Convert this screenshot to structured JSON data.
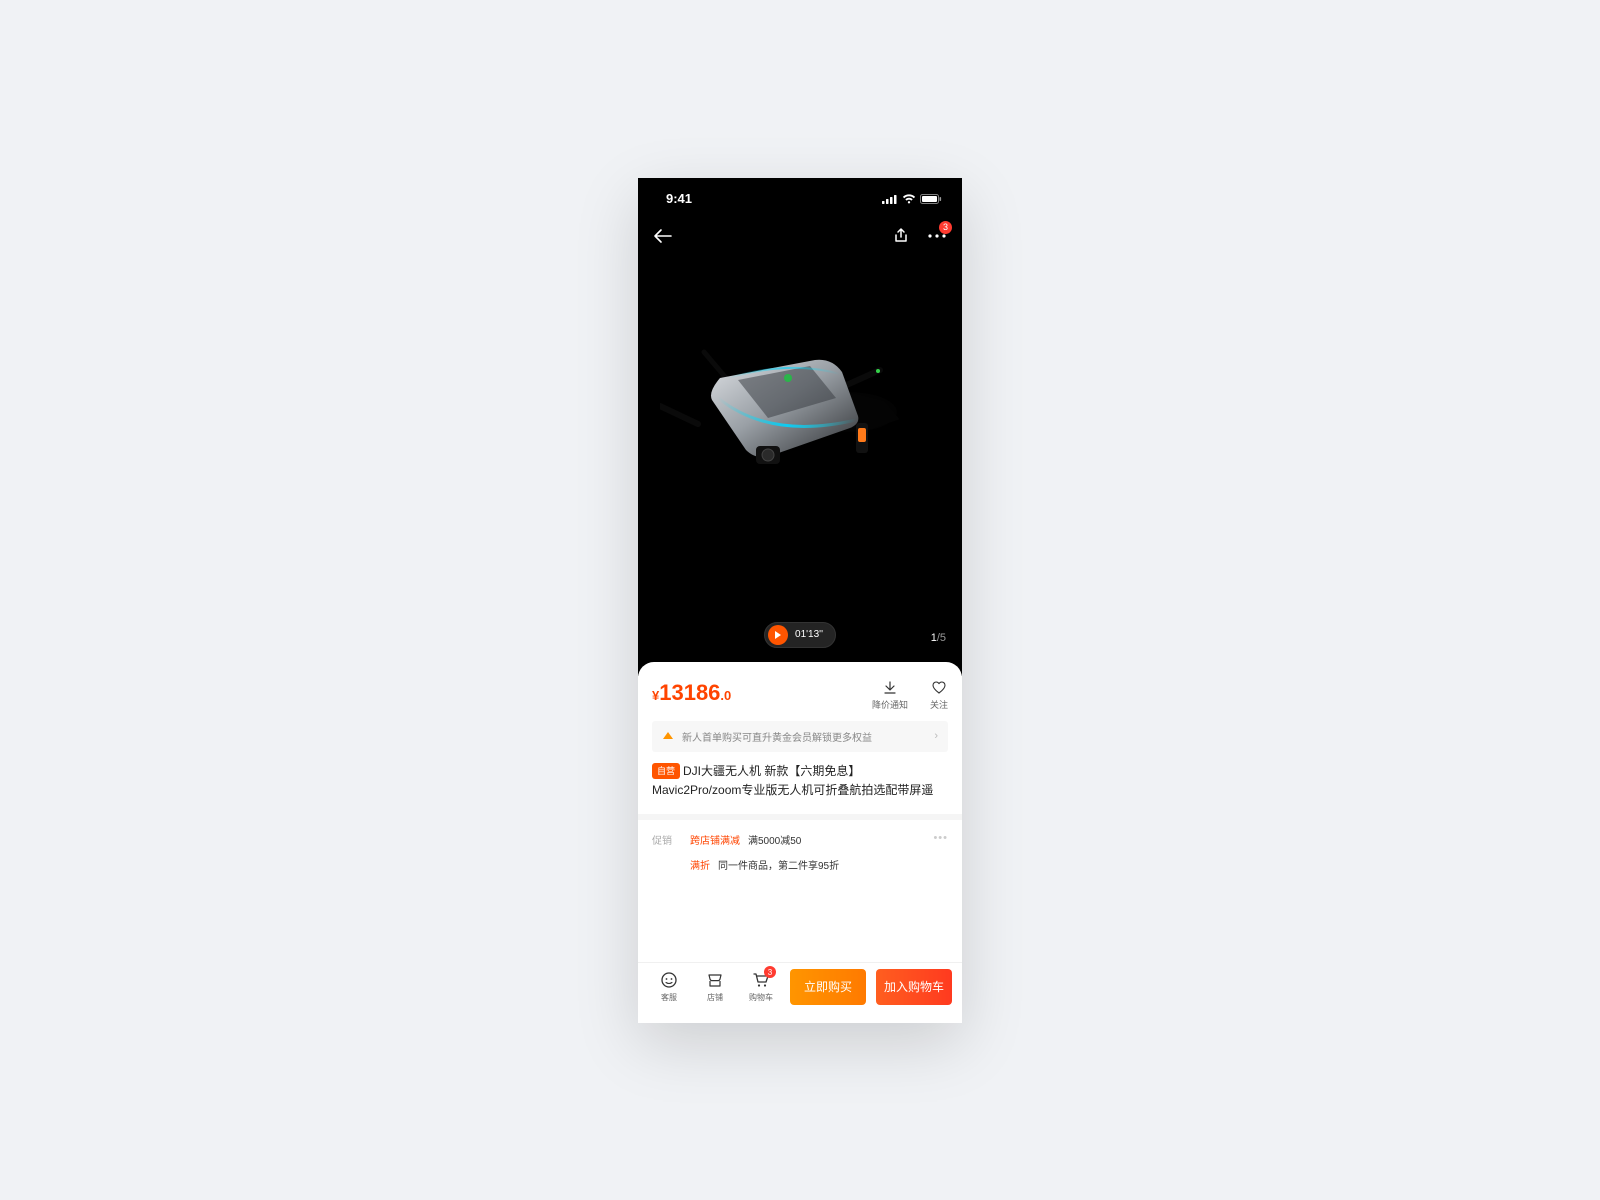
{
  "status": {
    "time": "9:41"
  },
  "nav": {
    "more_badge": "3"
  },
  "hero": {
    "video_duration": "01'13''",
    "page_current": "1",
    "page_total": "5"
  },
  "price": {
    "currency": "¥",
    "main": "13186",
    "decimal": ".0"
  },
  "actions": {
    "price_alert": "降价通知",
    "favorite": "关注"
  },
  "member_banner": {
    "text": "新人首单购买可直升黄金会员解锁更多权益"
  },
  "product": {
    "tag": "自营",
    "title": "DJI大疆无人机  新款【六期免息】Mavic2Pro/zoom专业版无人机可折叠航拍选配带屏遥"
  },
  "promo": {
    "label": "促销",
    "items": [
      {
        "tag": "跨店铺满减",
        "desc": "满5000减50"
      },
      {
        "tag": "满折",
        "desc": "同一件商品，第二件享95折"
      }
    ]
  },
  "bottom": {
    "service": "客服",
    "shop": "店铺",
    "cart": "购物车",
    "cart_badge": "3",
    "buy_now": "立即购买",
    "add_cart": "加入购物车"
  }
}
